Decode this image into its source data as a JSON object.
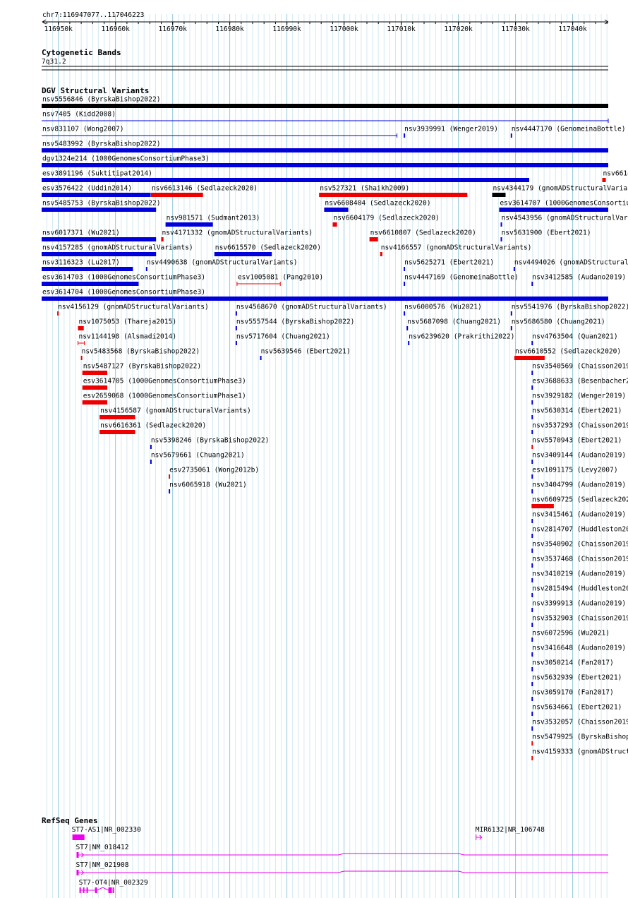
{
  "header": {
    "position_label": "chr7:116947077..117046223",
    "ticks": [
      "116950k",
      "116960k",
      "116970k",
      "116980k",
      "116990k",
      "117000k",
      "117010k",
      "117020k",
      "117030k",
      "117040k"
    ]
  },
  "cytoband": {
    "title": "Cytogenetic Bands",
    "band": "7q31.2"
  },
  "dgv": {
    "title": "DGV Structural Variants",
    "colors": {
      "loss": "#ee0000",
      "gain": "#0000dd",
      "both": "#000000"
    },
    "features": [
      {
        "label": "nsv5556846 (ByrskaBishop2022)",
        "start": 116947077,
        "end": 117046223,
        "type": "both"
      },
      {
        "label": "nsv7405 (Kidd2008)",
        "start": 116947077,
        "end": 117046223,
        "type": "gain",
        "style": "thin"
      },
      {
        "label": "nsv831107 (Wong2007)",
        "start": 116947077,
        "end": 117009260,
        "type": "gain",
        "style": "thin"
      },
      {
        "label": "nsv3939991 (Wenger2019)",
        "start": 117010430,
        "end": 117010560,
        "type": "gain"
      },
      {
        "label": "nsv4447170 (GenomeinaBottle)",
        "start": 117029160,
        "end": 117029300,
        "type": "gain"
      },
      {
        "label": "nsv5483992 (ByrskaBishop2022)",
        "start": 116947077,
        "end": 117046223,
        "type": "gain"
      },
      {
        "label": "dgv1324e214 (1000GenomesConsortiumPhase3)",
        "start": 116947077,
        "end": 117046223,
        "type": "gain"
      },
      {
        "label": "esv3891196 (Suktitipat2014)",
        "start": 116947077,
        "end": 117032390,
        "type": "gain"
      },
      {
        "label": "nsv6614",
        "start": 117045170,
        "end": 117045800,
        "type": "loss"
      },
      {
        "label": "esv3576422 (Uddin2014)",
        "start": 116947077,
        "end": 116966150,
        "type": "gain"
      },
      {
        "label": "nsv6613146 (Sedlazeck2020)",
        "start": 116966200,
        "end": 116975310,
        "type": "loss"
      },
      {
        "label": "nsv527321 (Shaikh2009)",
        "start": 116995630,
        "end": 117021570,
        "type": "loss"
      },
      {
        "label": "nsv4344179 (gnomADStructuralVariants)",
        "start": 117025910,
        "end": 117028260,
        "type": "both"
      },
      {
        "label": "nsv5485753 (ByrskaBishop2022)",
        "start": 116947077,
        "end": 116967100,
        "type": "gain"
      },
      {
        "label": "nsv981571 (Sudmant2013)",
        "start": 116968760,
        "end": 116977050,
        "type": "gain"
      },
      {
        "label": "nsv6608404 (Sedlazeck2020)",
        "start": 116996520,
        "end": 117000740,
        "type": "gain"
      },
      {
        "label": "esv3614707 (1000GenomesConsortiumPhase3)",
        "start": 117027140,
        "end": 117046223,
        "type": "gain"
      },
      {
        "label": "nsv6017371 (Wu2021)",
        "start": 116947077,
        "end": 116967100,
        "type": "gain"
      },
      {
        "label": "nsv4171332 (gnomADStructuralVariants)",
        "start": 116968000,
        "end": 116968400,
        "type": "loss"
      },
      {
        "label": "nsv6604179 (Sedlazeck2020)",
        "start": 116998010,
        "end": 116998760,
        "type": "loss"
      },
      {
        "label": "nsv4543956 (gnomADStructuralVariants)",
        "start": 117027390,
        "end": 117027520,
        "type": "gain"
      },
      {
        "label": "nsv4157285 (gnomADStructuralVariants)",
        "start": 116947077,
        "end": 116967100,
        "type": "gain"
      },
      {
        "label": "nsv6615570 (Sedlazeck2020)",
        "start": 116977300,
        "end": 116987350,
        "type": "gain"
      },
      {
        "label": "nsv6610807 (Sedlazeck2020)",
        "start": 117004440,
        "end": 117005930,
        "type": "loss"
      },
      {
        "label": "nsv5631900 (Ebert2021)",
        "start": 117027390,
        "end": 117027520,
        "type": "gain"
      },
      {
        "label": "nsv3116323 (Lu2017)",
        "start": 116947077,
        "end": 116963050,
        "type": "gain"
      },
      {
        "label": "nsv4490638 (gnomADStructuralVariants)",
        "start": 116965330,
        "end": 116965460,
        "type": "gain"
      },
      {
        "label": "nsv4166557 (gnomADStructuralVariants)",
        "start": 117006300,
        "end": 117006680,
        "type": "loss"
      },
      {
        "label": "esv3614703 (1000GenomesConsortiumPhase3)",
        "start": 116947077,
        "end": 116964060,
        "type": "gain"
      },
      {
        "label": "esv1005081 (Pang2010)",
        "start": 116981270,
        "end": 116988830,
        "type": "loss",
        "style": "range"
      },
      {
        "label": "nsv5625271 (Ebert2021)",
        "start": 117010430,
        "end": 117010560,
        "type": "gain"
      },
      {
        "label": "nsv4494026 (gnomADStructuralVariants)",
        "start": 117029660,
        "end": 117029790,
        "type": "gain"
      },
      {
        "label": "esv3614704 (1000GenomesConsortiumPhase3)",
        "start": 116947077,
        "end": 117046223,
        "type": "gain"
      },
      {
        "label": "nsv4156129 (gnomADStructuralVariants)",
        "start": 116949800,
        "end": 116949930,
        "type": "loss"
      },
      {
        "label": "nsv4568670 (gnomADStructuralVariants)",
        "start": 116981020,
        "end": 116981150,
        "type": "gain"
      },
      {
        "label": "nsv4447169 (GenomeinaBottle)",
        "start": 117010430,
        "end": 117010560,
        "type": "gain"
      },
      {
        "label": "nsv1075053 (Thareja2015)",
        "start": 116953440,
        "end": 116954450,
        "type": "loss"
      },
      {
        "label": "nsv5557544 (ByrskaBishop2022)",
        "start": 116981020,
        "end": 116981150,
        "type": "gain"
      },
      {
        "label": "nsv6000576 (Wu2021)",
        "start": 117010430,
        "end": 117010560,
        "type": "gain"
      },
      {
        "label": "nsv5541976 (ByrskaBishop2022)",
        "start": 117029160,
        "end": 117029290,
        "type": "gain"
      },
      {
        "label": "nsv1144198 (Alsmadi2014)",
        "start": 116953440,
        "end": 116954570,
        "type": "loss",
        "style": "range"
      },
      {
        "label": "nsv5717604 (Chuang2021)",
        "start": 116981020,
        "end": 116981150,
        "type": "gain"
      },
      {
        "label": "nsv5687098 (Chuang2021)",
        "start": 117010930,
        "end": 117011060,
        "type": "gain"
      },
      {
        "label": "nsv3412585 (Audano2019)",
        "start": 117032800,
        "end": 117032930,
        "type": "gain"
      },
      {
        "label": "nsv5483568 (ByrskaBishop2022)",
        "start": 116953940,
        "end": 116954070,
        "type": "loss"
      },
      {
        "label": "nsv5639546 (Ebert2021)",
        "start": 116985300,
        "end": 116985430,
        "type": "gain"
      },
      {
        "label": "nsv6239620 (Prakrithi2022)",
        "start": 117011180,
        "end": 117011310,
        "type": "gain"
      },
      {
        "label": "nsv5487127 (ByrskaBishop2022)",
        "start": 116954200,
        "end": 116958560,
        "type": "loss"
      },
      {
        "label": "nsv5686580 (Chuang2021)",
        "start": 117029160,
        "end": 117029290,
        "type": "gain"
      },
      {
        "label": "esv3614705 (1000GenomesConsortiumPhase3)",
        "start": 116954200,
        "end": 116958560,
        "type": "loss"
      },
      {
        "label": "nsv6610552 (Sedlazeck2020)",
        "start": 117029800,
        "end": 117035100,
        "type": "loss"
      },
      {
        "label": "esv2659068 (1000GenomesConsortiumPhase1)",
        "start": 116954200,
        "end": 116958560,
        "type": "loss"
      },
      {
        "label": "nsv4763504 (Quan2021)",
        "start": 117032800,
        "end": 117032930,
        "type": "gain"
      },
      {
        "label": "nsv4156587 (gnomADStructuralVariants)",
        "start": 116957210,
        "end": 116963430,
        "type": "loss"
      },
      {
        "label": "nsv3540569 (Chaisson2019)",
        "start": 117032800,
        "end": 117032930,
        "type": "gain"
      },
      {
        "label": "nsv6616361 (Sedlazeck2020)",
        "start": 116957210,
        "end": 116963430,
        "type": "loss"
      },
      {
        "label": "esv3688633 (Besenbacher2016)",
        "start": 117032800,
        "end": 117032930,
        "type": "gain"
      },
      {
        "label": "nsv5398246 (ByrskaBishop2022)",
        "start": 116966080,
        "end": 116966210,
        "type": "gain"
      },
      {
        "label": "nsv3929182 (Wenger2019)",
        "start": 117032800,
        "end": 117032930,
        "type": "gain"
      },
      {
        "label": "nsv5679661 (Chuang2021)",
        "start": 116966080,
        "end": 116966210,
        "type": "gain"
      },
      {
        "label": "nsv5630314 (Ebert2021)",
        "start": 117032800,
        "end": 117032930,
        "type": "gain"
      },
      {
        "label": "esv2735061 (Wong2012b)",
        "start": 116969310,
        "end": 116969440,
        "type": "loss"
      },
      {
        "label": "nsv3537293 (Chaisson2019)",
        "start": 117032800,
        "end": 117032930,
        "type": "gain"
      },
      {
        "label": "nsv6065918 (Wu2021)",
        "start": 116969310,
        "end": 116969440,
        "type": "gain"
      },
      {
        "label": "nsv5570943 (Ebert2021)",
        "start": 117032800,
        "end": 117032930,
        "type": "loss"
      },
      {
        "label": "nsv3409144 (Audano2019)",
        "start": 117032800,
        "end": 117032930,
        "type": "gain"
      },
      {
        "label": "esv1091175 (Levy2007)",
        "start": 117032800,
        "end": 117032930,
        "type": "gain"
      },
      {
        "label": "nsv3404799 (Audano2019)",
        "start": 117032800,
        "end": 117032930,
        "type": "gain"
      },
      {
        "label": "nsv6609725 (Sedlazeck2020)",
        "start": 117032800,
        "end": 117036700,
        "type": "loss"
      },
      {
        "label": "nsv3415461 (Audano2019)",
        "start": 117032800,
        "end": 117032930,
        "type": "gain"
      },
      {
        "label": "nsv2814707 (Huddleston2017)",
        "start": 117032800,
        "end": 117032930,
        "type": "gain"
      },
      {
        "label": "nsv3540902 (Chaisson2019)",
        "start": 117032800,
        "end": 117032930,
        "type": "gain"
      },
      {
        "label": "nsv3537468 (Chaisson2019)",
        "start": 117032800,
        "end": 117032930,
        "type": "gain"
      },
      {
        "label": "nsv3410219 (Audano2019)",
        "start": 117032800,
        "end": 117032930,
        "type": "gain"
      },
      {
        "label": "nsv2815494 (Huddleston2017)",
        "start": 117032800,
        "end": 117032930,
        "type": "gain"
      },
      {
        "label": "nsv3399913 (Audano2019)",
        "start": 117032800,
        "end": 117032930,
        "type": "gain"
      },
      {
        "label": "nsv3532903 (Chaisson2019)",
        "start": 117032800,
        "end": 117032930,
        "type": "gain"
      },
      {
        "label": "nsv6072596 (Wu2021)",
        "start": 117032800,
        "end": 117032930,
        "type": "gain"
      },
      {
        "label": "nsv3416648 (Audano2019)",
        "start": 117032800,
        "end": 117032930,
        "type": "gain"
      },
      {
        "label": "nsv3050214 (Fan2017)",
        "start": 117032800,
        "end": 117032930,
        "type": "gain"
      },
      {
        "label": "nsv5632939 (Ebert2021)",
        "start": 117032800,
        "end": 117032930,
        "type": "gain"
      },
      {
        "label": "nsv3059170 (Fan2017)",
        "start": 117032800,
        "end": 117032930,
        "type": "gain"
      },
      {
        "label": "nsv5634661 (Ebert2021)",
        "start": 117032800,
        "end": 117032930,
        "type": "gain"
      },
      {
        "label": "nsv3532057 (Chaisson2019)",
        "start": 117032800,
        "end": 117032930,
        "type": "gain"
      },
      {
        "label": "nsv5479925 (ByrskaBishop2022)",
        "start": 117032800,
        "end": 117032930,
        "type": "loss"
      },
      {
        "label": "nsv4159333 (gnomADStructuralVariants)",
        "start": 117032800,
        "end": 117032930,
        "type": "loss"
      }
    ]
  },
  "refseq": {
    "title": "RefSeq Genes",
    "color": "#ee00ee",
    "genes": [
      {
        "label": "ST7-AS1|NR_002330",
        "start": 116952460,
        "end": 116954570,
        "style": "block"
      },
      {
        "label": "MIR6132|NR_106748",
        "start": 117023100,
        "end": 117023200,
        "style": "arrow"
      },
      {
        "label": "ST7|NM_018412",
        "start": 116953190,
        "end": 117046223,
        "style": "gene"
      },
      {
        "label": "ST7|NM_021908",
        "start": 116953190,
        "end": 117046223,
        "style": "gene"
      },
      {
        "label": "ST7-OT4|NR_002329",
        "start": 116953690,
        "end": 116960500,
        "style": "exons"
      }
    ]
  }
}
